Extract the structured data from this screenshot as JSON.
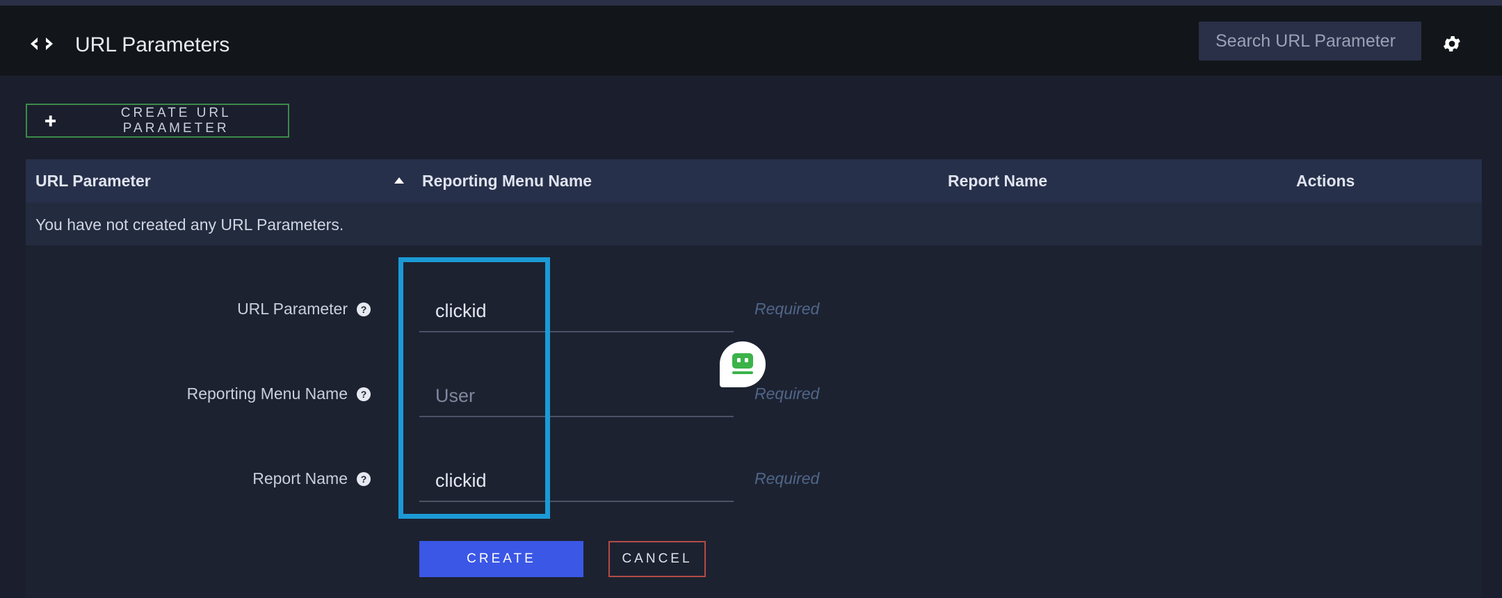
{
  "header": {
    "icon": "code-arrows-icon",
    "title": "URL Parameters",
    "search_placeholder": "Search URL Parameter",
    "settings_icon": "gear-icon"
  },
  "toolbar": {
    "create_label": "CREATE URL PARAMETER",
    "create_icon": "plus-icon",
    "create_border_color": "#3c8a4a"
  },
  "table": {
    "columns": [
      "URL Parameter",
      "Reporting Menu Name",
      "Report Name",
      "Actions"
    ],
    "sort_column": "URL Parameter",
    "sort_direction": "ascending",
    "empty_message": "You have not created any URL Parameters."
  },
  "form": {
    "fields": [
      {
        "label": "URL Parameter",
        "value": "clickid",
        "placeholder": "",
        "hint": "Required"
      },
      {
        "label": "Reporting Menu Name",
        "value": "",
        "placeholder": "User",
        "hint": "Required"
      },
      {
        "label": "Report Name",
        "value": "clickid",
        "placeholder": "",
        "hint": "Required"
      }
    ],
    "create_label": "CREATE",
    "cancel_label": "CANCEL"
  },
  "colors": {
    "accent_blue": "#3b57e6",
    "highlight": "#1b9ad6",
    "cancel_border": "#b44b47",
    "header_bg": "#12161b",
    "page_bg": "#1b1f2d"
  }
}
